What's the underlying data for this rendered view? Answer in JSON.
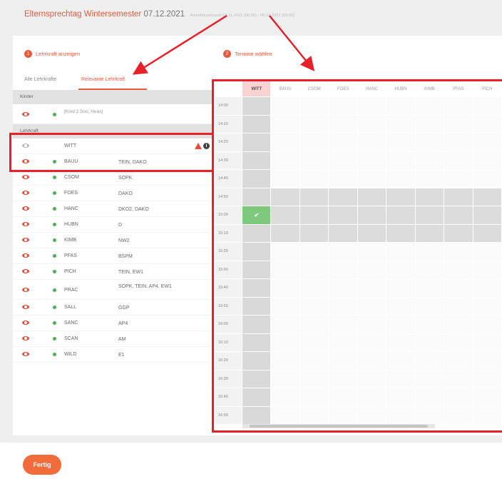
{
  "header": {
    "title": "Elternsprechtag Wintersemester",
    "date": "07.12.2021",
    "subtitle": "Anmeldezeitraum 18.11.2021 (00:00) - 06.12.2021 (00:00)"
  },
  "left_panel": {
    "step_number": "1",
    "step_label": "Lehrkraft anzeigen",
    "tabs": [
      {
        "label": "Alle Lehrkräfte",
        "active": false
      },
      {
        "label": "Relevante Lehrkraft",
        "active": true
      }
    ],
    "children_header": "Kinder",
    "child_name": "[Kind 2 Soo, Heas]",
    "teacher_header": "Lehrkraft",
    "selected_teacher": "WITT",
    "teachers": [
      {
        "abbr": "BAUU",
        "subjects": "TEIN, DAKO"
      },
      {
        "abbr": "CSOM",
        "subjects": "SOPK"
      },
      {
        "abbr": "FOES",
        "subjects": "DAKO"
      },
      {
        "abbr": "HANC",
        "subjects": "DKO2, DAKO"
      },
      {
        "abbr": "HUBN",
        "subjects": "D"
      },
      {
        "abbr": "KIMB",
        "subjects": "NW2"
      },
      {
        "abbr": "PFAS",
        "subjects": "BSPM"
      },
      {
        "abbr": "PICH",
        "subjects": "TEIN, EW1"
      },
      {
        "abbr": "PRAC",
        "subjects": "SOPK, TEIN, AP4, EW1"
      },
      {
        "abbr": "SALL",
        "subjects": "GGP"
      },
      {
        "abbr": "SANC",
        "subjects": "AP4"
      },
      {
        "abbr": "SCAN",
        "subjects": "AM"
      },
      {
        "abbr": "WILD",
        "subjects": "E1"
      }
    ]
  },
  "right_panel": {
    "step_number": "2",
    "step_label": "Termine wählen",
    "columns": [
      "WITT",
      "BAUU",
      "CSOM",
      "FOES",
      "HANC",
      "HUBN",
      "KIMB",
      "PFAS",
      "PICH"
    ],
    "times": [
      "14:00",
      "14:10",
      "14:20",
      "14:30",
      "14:40",
      "14:50",
      "15:00",
      "15:10",
      "15:20",
      "15:30",
      "15:40",
      "15:50",
      "16:00",
      "16:10",
      "16:20",
      "16:30",
      "16:40",
      "16:50"
    ],
    "busy_times": [
      "14:50",
      "15:00",
      "15:10"
    ],
    "booked": {
      "time": "15:00",
      "column": "WITT",
      "mark": "✔"
    }
  },
  "footer": {
    "done_label": "Fertig"
  },
  "colors": {
    "accent": "#e85a3c",
    "highlight_box": "#e8202a",
    "booked": "#7fc97f",
    "available_dot": "#4caf50"
  }
}
